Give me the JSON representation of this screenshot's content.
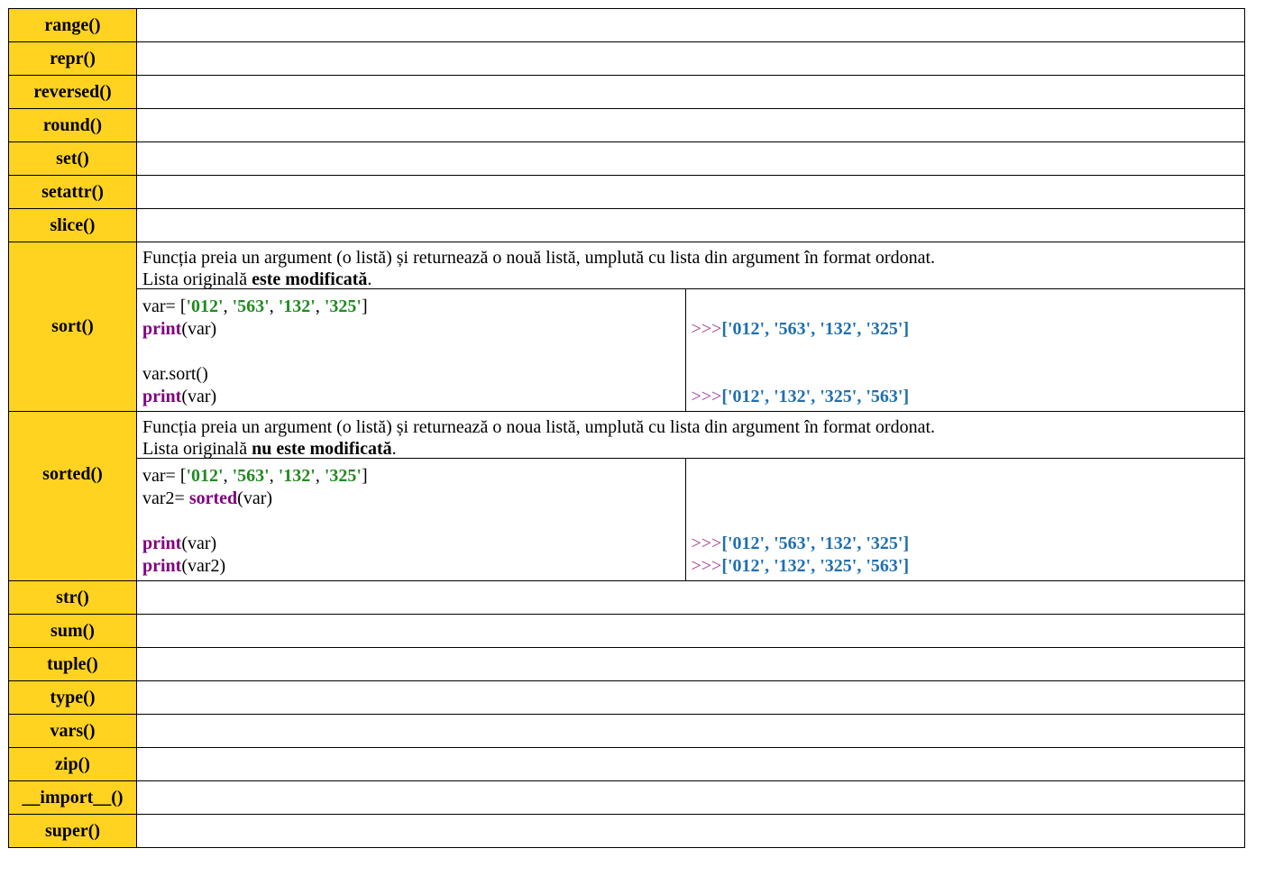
{
  "functions_top": [
    "range()",
    "repr()",
    "reversed()",
    "round()",
    "set()",
    "setattr()",
    "slice()"
  ],
  "sort": {
    "name": "sort()",
    "desc_line1": "Funcția preia un argument (o listă) și returnează o nouă listă, umplută cu lista din argument în format ordonat.",
    "desc_line2_prefix": "Lista originală ",
    "desc_line2_bold": "este modificată",
    "desc_line2_suffix": ".",
    "code": {
      "var_assign": "var= [",
      "s1": "'012'",
      "s2": "'563'",
      "s3": "'132'",
      "s4": "'325'",
      "comma": ", ",
      "close": "]",
      "print_kw": "print",
      "print_arg": "(var)",
      "sort_call": "var.sort()"
    },
    "output": {
      "prompt": ">>>",
      "out1": "['012', '563', '132', '325']",
      "out2": "['012', '132', '325', '563']"
    }
  },
  "sorted": {
    "name": "sorted()",
    "desc_line1": "Funcția preia un argument (o listă) și returnează o noua listă, umplută cu lista din argument în format ordonat.",
    "desc_line2_prefix": "Lista originală ",
    "desc_line2_bold": "nu este modificată",
    "desc_line2_suffix": ".",
    "code": {
      "var_assign": "var= [",
      "s1": "'012'",
      "s2": "'563'",
      "s3": "'132'",
      "s4": "'325'",
      "comma": ", ",
      "close": "]",
      "var2_assign": "var2= ",
      "sorted_kw": "sorted",
      "sorted_arg": "(var)",
      "print_kw": "print",
      "print_arg1": "(var)",
      "print_arg2": "(var2)"
    },
    "output": {
      "prompt": ">>>",
      "out1": "['012', '563', '132', '325']",
      "out2": "['012', '132', '325', '563']"
    }
  },
  "functions_bottom": [
    "str()",
    "sum()",
    "tuple()",
    "type()",
    "vars()",
    "zip()",
    "__import__()",
    "super()"
  ],
  "colors": {
    "name_cell_bg": "#ffd320",
    "string": "#218a21",
    "keyword": "#800080",
    "prompt": "#a3358f",
    "output": "#1f6fb0"
  }
}
